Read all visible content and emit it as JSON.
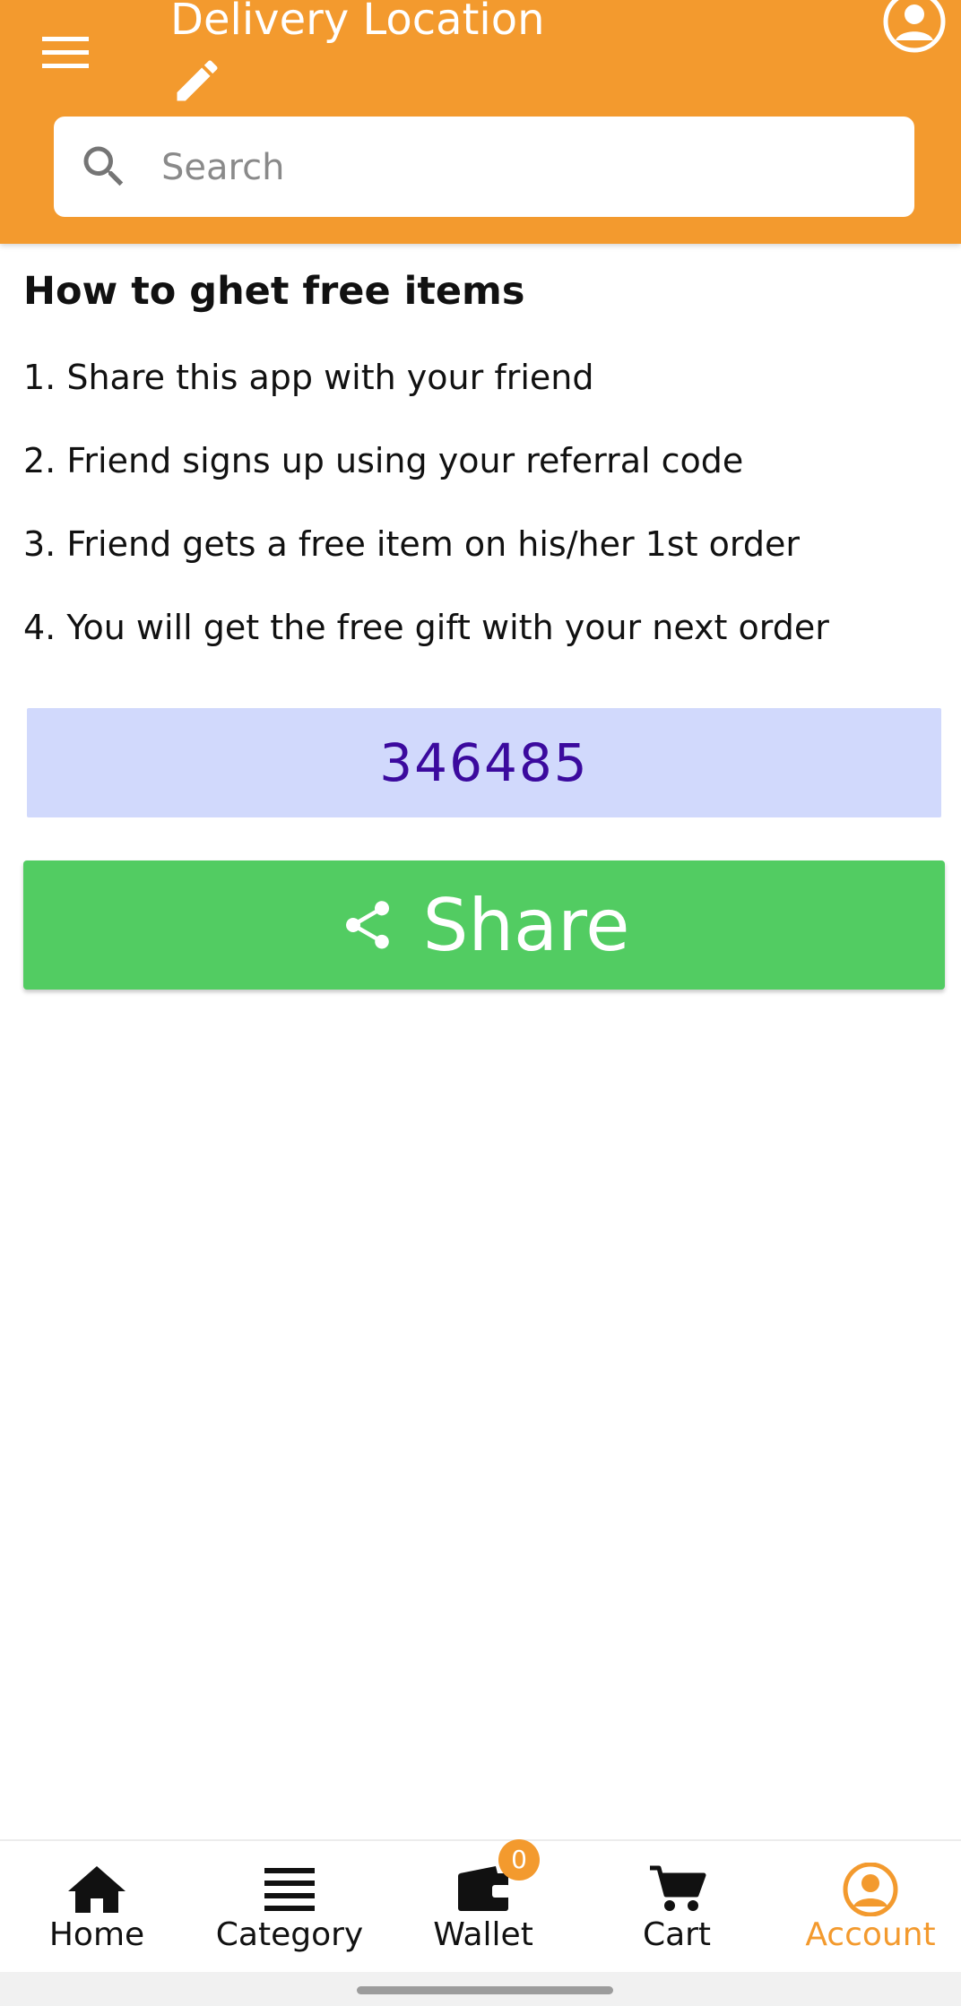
{
  "header": {
    "title": "Delivery Location",
    "menu_icon": "menu-icon",
    "edit_icon": "pencil-icon",
    "account_icon": "account-circle-icon",
    "background_color": "#f39a2e"
  },
  "search": {
    "placeholder": "Search",
    "value": "",
    "icon": "search-icon"
  },
  "content": {
    "heading": "How to ghet free items",
    "steps": [
      "1. Share this app with your friend",
      "2. Friend signs up using your referral code",
      "3. Friend gets a free item on his/her 1st order",
      "4. You will get the free gift with your next order"
    ],
    "referral_code": "346485",
    "share_label": "Share",
    "share_icon": "share-icon",
    "share_color": "#52cc62",
    "code_background": "#d1d9fc",
    "code_color": "#3b0a9e"
  },
  "bottom_nav": {
    "items": [
      {
        "label": "Home",
        "icon": "home-icon",
        "active": false
      },
      {
        "label": "Category",
        "icon": "list-icon",
        "active": false
      },
      {
        "label": "Wallet",
        "icon": "wallet-icon",
        "active": false
      },
      {
        "label": "Cart",
        "icon": "cart-icon",
        "active": false
      },
      {
        "label": "Account",
        "icon": "account-icon",
        "active": true
      }
    ],
    "cart_badge": "0",
    "active_color": "#f39a2e"
  }
}
